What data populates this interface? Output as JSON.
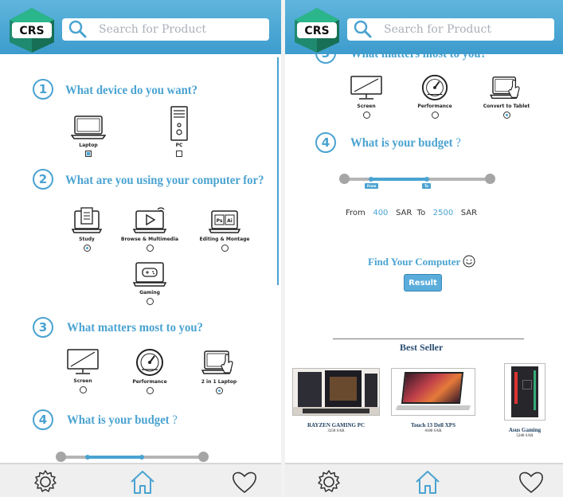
{
  "brand": {
    "logo_text": "CRS"
  },
  "search": {
    "placeholder": "Search for Product"
  },
  "questions": {
    "device": {
      "number": "1",
      "title": "What device do you want?",
      "options": [
        "Laptop",
        "PC"
      ]
    },
    "usage": {
      "number": "2",
      "title": "What are you using your computer for?",
      "options": [
        "Study",
        "Browse & Multimedia",
        "Editing & Montage",
        "Gaming"
      ]
    },
    "matters_left": {
      "number": "3",
      "title": "What matters most to you?",
      "options": [
        "Screen",
        "Performance",
        "2 in 1 Laptop"
      ]
    },
    "budget_left": {
      "number": "4",
      "title": "What is your budget",
      "suffix": "?"
    },
    "matters_right": {
      "number": "3",
      "title": "What matters most to you?",
      "options": [
        "Screen",
        "Performance",
        "Convert to Tablet"
      ]
    },
    "budget_right": {
      "number": "4",
      "title": "What is your budget",
      "suffix": "?"
    }
  },
  "slider": {
    "from_tag": "From",
    "to_tag": "To"
  },
  "budget_range": {
    "from_label": "From",
    "from_value": "400",
    "currency": "SAR",
    "to_label": "To",
    "to_value": "2500"
  },
  "find": {
    "label": "Find Your Computer",
    "button": "Result"
  },
  "best_seller": {
    "title": "Best Seller",
    "products": [
      {
        "name": "RAYZEN GAMING PC",
        "price": "3250 SAR"
      },
      {
        "name": "Touch 13 Dell XPS",
        "price": "4100 SAR"
      },
      {
        "name": "Asus Gaming",
        "price": "5240 SAR"
      }
    ]
  },
  "colors": {
    "accent": "#4aa3d1",
    "topbar": "#4ea8d6",
    "logo_green": "#1f8a70"
  },
  "icons": [
    "search-icon",
    "settings-icon",
    "home-icon",
    "heart-icon"
  ]
}
